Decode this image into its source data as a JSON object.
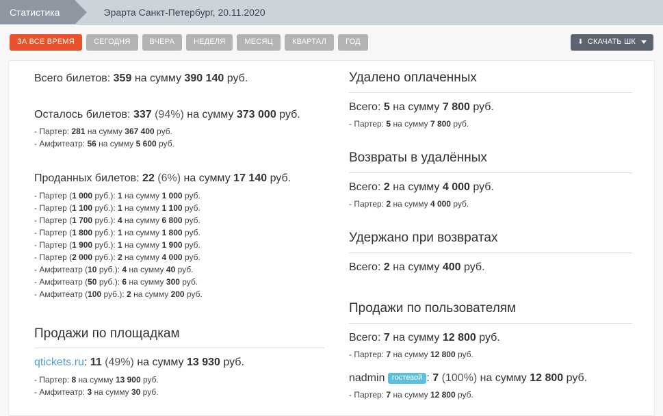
{
  "header": {
    "crumb_active": "Статистика",
    "crumb_current": "Эрарта Санкт-Петербург, 20.11.2020"
  },
  "toolbar": {
    "periods": [
      {
        "label": "ЗА ВСЕ ВРЕМЯ",
        "active": true
      },
      {
        "label": "СЕГОДНЯ",
        "active": false
      },
      {
        "label": "ВЧЕРА",
        "active": false
      },
      {
        "label": "НЕДЕЛЯ",
        "active": false
      },
      {
        "label": "МЕСЯЦ",
        "active": false
      },
      {
        "label": "КВАРТАЛ",
        "active": false
      },
      {
        "label": "ГОД",
        "active": false
      }
    ],
    "download_label": "СКАЧАТЬ ШК",
    "download_icon": "download-icon",
    "caret_icon": "caret-down-icon",
    "active_color": "#e8512a",
    "default_color": "#b3b3b3",
    "dark_color": "#5b6470"
  },
  "left": {
    "total": {
      "label": "Всего билетов:",
      "count": "359",
      "mid": "на сумму",
      "sum": "390 140",
      "unit": "руб."
    },
    "remaining": {
      "label": "Осталось билетов:",
      "count": "337",
      "percent": "(94%)",
      "mid": "на сумму",
      "sum": "373 000",
      "unit": "руб.",
      "rows": [
        {
          "name": "- Партер:",
          "count": "281",
          "mid": "на сумму",
          "sum": "367 400",
          "unit": "руб."
        },
        {
          "name": "- Амфитеатр:",
          "count": "56",
          "mid": "на сумму",
          "sum": "5 600",
          "unit": "руб."
        }
      ]
    },
    "sold": {
      "label": "Проданных билетов:",
      "count": "22",
      "percent": "(6%)",
      "mid": "на сумму",
      "sum": "17 140",
      "unit": "руб.",
      "rows": [
        {
          "name": "- Партер (",
          "price": "1 000",
          "price_unit": "руб.):",
          "count": "1",
          "mid": "на сумму",
          "sum": "1 000",
          "unit": "руб."
        },
        {
          "name": "- Партер (",
          "price": "1 100",
          "price_unit": "руб.):",
          "count": "1",
          "mid": "на сумму",
          "sum": "1 100",
          "unit": "руб."
        },
        {
          "name": "- Партер (",
          "price": "1 700",
          "price_unit": "руб.):",
          "count": "4",
          "mid": "на сумму",
          "sum": "6 800",
          "unit": "руб."
        },
        {
          "name": "- Партер (",
          "price": "1 800",
          "price_unit": "руб.):",
          "count": "1",
          "mid": "на сумму",
          "sum": "1 800",
          "unit": "руб."
        },
        {
          "name": "- Партер (",
          "price": "1 900",
          "price_unit": "руб.):",
          "count": "1",
          "mid": "на сумму",
          "sum": "1 900",
          "unit": "руб."
        },
        {
          "name": "- Партер (",
          "price": "2 000",
          "price_unit": "руб.):",
          "count": "2",
          "mid": "на сумму",
          "sum": "4 000",
          "unit": "руб."
        },
        {
          "name": "- Амфитеатр (",
          "price": "10",
          "price_unit": "руб.):",
          "count": "4",
          "mid": "на сумму",
          "sum": "40",
          "unit": "руб."
        },
        {
          "name": "- Амфитеатр (",
          "price": "50",
          "price_unit": "руб.):",
          "count": "6",
          "mid": "на сумму",
          "sum": "300",
          "unit": "руб."
        },
        {
          "name": "- Амфитеатр (",
          "price": "100",
          "price_unit": "руб.):",
          "count": "2",
          "mid": "на сумму",
          "sum": "200",
          "unit": "руб."
        }
      ]
    },
    "by_venue": {
      "title": "Продажи по площадкам",
      "source_link": "qtickets.ru",
      "colon": ":",
      "count": "11",
      "percent": "(49%)",
      "mid": "на сумму",
      "sum": "13 930",
      "unit": "руб.",
      "rows": [
        {
          "name": "- Партер:",
          "count": "8",
          "mid": "на сумму",
          "sum": "13 900",
          "unit": "руб."
        },
        {
          "name": "- Амфитеатр:",
          "count": "3",
          "mid": "на сумму",
          "sum": "30",
          "unit": "руб."
        }
      ]
    }
  },
  "right": {
    "deleted_paid": {
      "title": "Удалено оплаченных",
      "total_label": "Всего:",
      "count": "5",
      "mid": "на сумму",
      "sum": "7 800",
      "unit": "руб.",
      "rows": [
        {
          "name": "- Партер:",
          "count": "5",
          "mid": "на сумму",
          "sum": "7 800",
          "unit": "руб."
        }
      ]
    },
    "refunds_deleted": {
      "title": "Возвраты в удалённых",
      "total_label": "Всего:",
      "count": "2",
      "mid": "на сумму",
      "sum": "4 000",
      "unit": "руб.",
      "rows": [
        {
          "name": "- Партер:",
          "count": "2",
          "mid": "на сумму",
          "sum": "4 000",
          "unit": "руб."
        }
      ]
    },
    "withheld": {
      "title": "Удержано при возвратах",
      "total_label": "Всего:",
      "count": "2",
      "mid": "на сумму",
      "sum": "400",
      "unit": "руб."
    },
    "by_user": {
      "title": "Продажи по пользователям",
      "total_label": "Всего:",
      "count": "7",
      "mid": "на сумму",
      "sum": "12 800",
      "unit": "руб.",
      "total_rows": [
        {
          "name": "- Партер:",
          "count": "7",
          "mid": "на сумму",
          "sum": "12 800",
          "unit": "руб."
        }
      ],
      "user": {
        "name": "nadmin",
        "badge": "гостевой",
        "badge_color": "#5bc0de",
        "colon": ":",
        "count": "7",
        "percent": "(100%)",
        "mid": "на сумму",
        "sum": "12 800",
        "unit": "руб.",
        "rows": [
          {
            "name": "- Партер:",
            "count": "7",
            "mid": "на сумму",
            "sum": "12 800",
            "unit": "руб."
          }
        ]
      }
    }
  }
}
